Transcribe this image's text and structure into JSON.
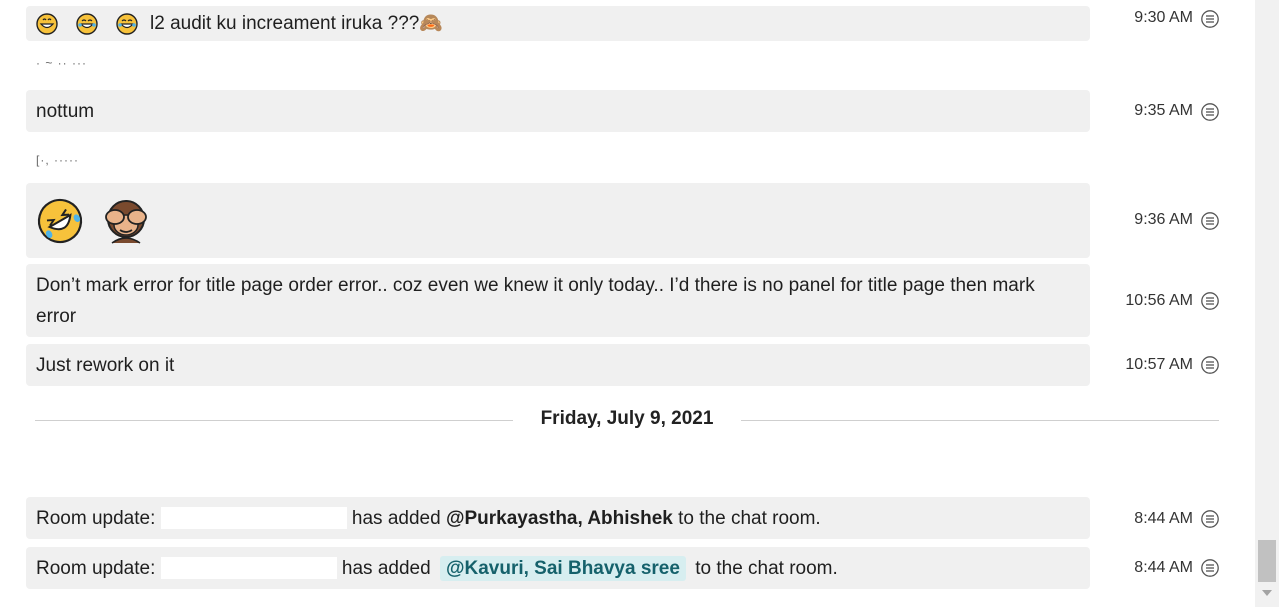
{
  "messages": [
    {
      "emojis": [
        "😁",
        "😂",
        "😂"
      ],
      "text": "l2 audit ku increament iruka ???🙈",
      "time": "9:30 AM"
    },
    {
      "text": "nottum",
      "time": "9:35 AM"
    },
    {
      "big_emojis": [
        "🤣",
        "🙈"
      ],
      "time": "9:36 AM"
    },
    {
      "text": "Don’t mark error for title page order error.. coz even we knew it only today.. I’d there is no panel for title page then mark error",
      "time": "10:56 AM"
    },
    {
      "text": "Just rework on it",
      "time": "10:57 AM"
    }
  ],
  "sender_labels": [
    "· ~ ·· ···",
    "[·, ·····"
  ],
  "date_divider": "Friday, July 9, 2021",
  "room_updates": [
    {
      "prefix": "Room update:",
      "middle": "has added",
      "mention": "@Purkayastha, Abhishek",
      "suffix": "to the chat room.",
      "time": "8:44 AM"
    },
    {
      "prefix": "Room update:",
      "middle": "has added",
      "mention": "@Kavuri, Sai Bhavya sree",
      "suffix": "to the chat room.",
      "time": "8:44 AM"
    }
  ],
  "icons": {
    "message_menu": "message-options-icon"
  }
}
